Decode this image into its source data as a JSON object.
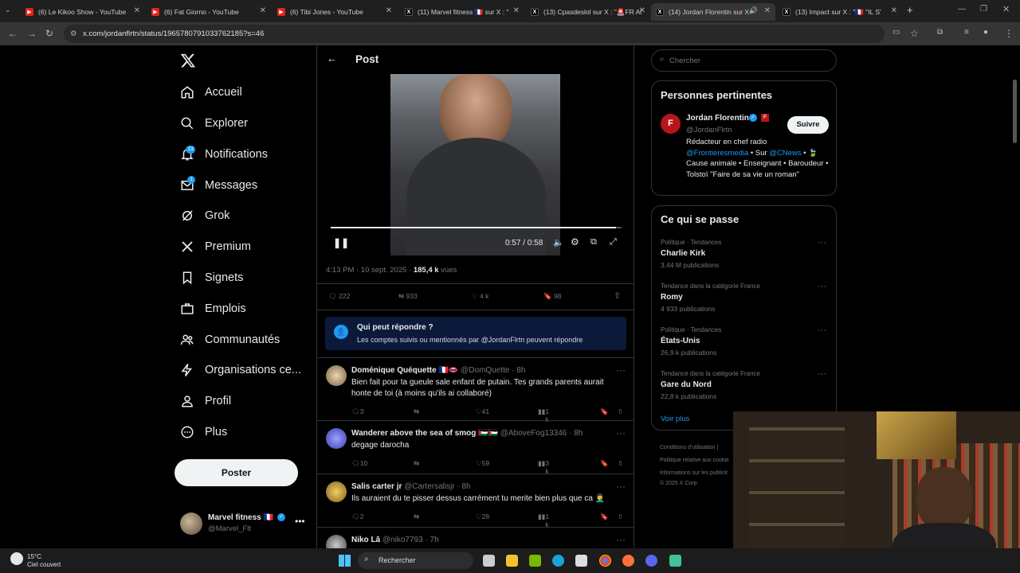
{
  "tabs": [
    {
      "title": "(6) Le Kikoo Show - YouTube",
      "type": "yt"
    },
    {
      "title": "(6) Fat Giorno - YouTube",
      "type": "yt"
    },
    {
      "title": "(6) Tibi Jones - YouTube",
      "type": "yt"
    },
    {
      "title": "(11) Marvel fitness 🇫🇷 sur X : \"",
      "type": "x"
    },
    {
      "title": "(13) Cpasdeslol sur X : \"🚨FR Al",
      "type": "x"
    },
    {
      "title": "(14) Jordan Florentin sur X",
      "type": "x"
    },
    {
      "title": "(13) Impact sur X : \"🇫🇷 \"IL S'",
      "type": "x"
    }
  ],
  "url": "x.com/jordanflrtn/status/1965780791033762185?s=46",
  "sidebar": {
    "items": [
      {
        "label": "Accueil"
      },
      {
        "label": "Explorer"
      },
      {
        "label": "Notifications",
        "badge": "13"
      },
      {
        "label": "Messages",
        "badge": "1"
      },
      {
        "label": "Grok"
      },
      {
        "label": "Premium"
      },
      {
        "label": "Signets"
      },
      {
        "label": "Emplois"
      },
      {
        "label": "Communautés"
      },
      {
        "label": "Organisations ce..."
      },
      {
        "label": "Profil"
      },
      {
        "label": "Plus"
      }
    ],
    "post_button": "Poster",
    "account_name": "Marvel fitness 🇫🇷",
    "account_handle": "@Marvel_Flt"
  },
  "main": {
    "header": "Post",
    "video_time": "0:57 / 0:58",
    "video_progress": 0.98,
    "meta_time": "4:13 PM · 10 sept. 2025 · ",
    "views": "185,4 k",
    "views_label": " vues",
    "stats": {
      "replies": "222",
      "reposts": "933",
      "likes": "4 k",
      "bookmarks": "98"
    },
    "reply_box_title": "Qui peut répondre ?",
    "reply_box_text": "Les comptes suivis ou mentionnés par @JordanFlrtn peuvent répondre",
    "replies": [
      {
        "name": "Doménique Quéquette 🇫🇷👄",
        "handle": "@DomQuette · 8h",
        "text": "Bien fait pour ta gueule sale enfant de putain. Tes grands parents aurait honte de toi (à moins qu'ils ai collaboré)",
        "r": "3",
        "l": "41",
        "v": "1 k"
      },
      {
        "name": "Wanderer above the sea of smog 🇵🇸🇵🇸",
        "handle": "@AboveFog13346 · 8h",
        "text": "degage darocha",
        "r": "10",
        "l": "59",
        "v": "3 k"
      },
      {
        "name": "Salis carter jr",
        "handle": "@Cartersalisjr · 8h",
        "text": "Ils auraient du te pisser dessus carrément tu merite bien plus que ca 🤦‍♂️",
        "r": "2",
        "l": "28",
        "v": "1 k"
      },
      {
        "name": "Niko Lā",
        "handle": "@niko7793 · 7h",
        "text": "",
        "r": "",
        "l": "",
        "v": ""
      }
    ]
  },
  "right": {
    "search_placeholder": "Chercher",
    "relevant_title": "Personnes pertinentes",
    "person_name": "Jordan Florentin",
    "person_handle": "@JordanFlrtn",
    "follow_label": "Suivre",
    "bio_line1": "Rédacteur en chef radio",
    "bio_link1": "@Frontieresmedia",
    "bio_mid": " • Sur ",
    "bio_link2": "@CNews",
    "bio_rest": " • 🍃 Cause animale • Enseignant • Baroudeur • Tolstoï \"Faire de sa vie un roman\"",
    "trends_title": "Ce qui se passe",
    "trends": [
      {
        "cat": "Politique · Tendances",
        "name": "Charlie Kirk",
        "count": "3,44 M publications"
      },
      {
        "cat": "Tendance dans la catégorie France",
        "name": "Romy",
        "count": "4 933 publications"
      },
      {
        "cat": "Politique · Tendances",
        "name": "États-Unis",
        "count": "26,9 k publications"
      },
      {
        "cat": "Tendance dans la catégorie France",
        "name": "Gare du Nord",
        "count": "22,8 k publications"
      }
    ],
    "see_more": "Voir plus",
    "footer": [
      "Conditions d'utilisation |",
      "Politique relative aux cookie",
      "Informations sur les publicit",
      "© 2025 X Corp."
    ]
  },
  "taskbar": {
    "temp": "15°C",
    "weather": "Ciel couvert",
    "search": "Rechercher"
  },
  "colors": {
    "accent": "#1d9bf0",
    "bg": "#000000",
    "border": "#2f3336"
  }
}
